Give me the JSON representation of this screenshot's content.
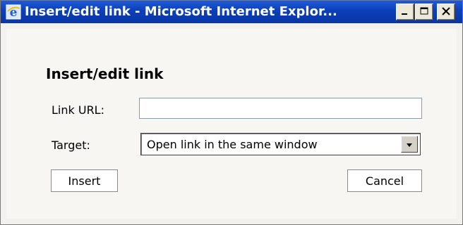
{
  "window": {
    "title": "Insert/edit link - Microsoft Internet Explor...",
    "icon": "ie-icon",
    "controls": [
      "minimize-icon",
      "maximize-icon",
      "close-icon"
    ],
    "title_bar_color": "#0b3fb8"
  },
  "dialog": {
    "heading": "Insert/edit link",
    "link_url_label": "Link URL:",
    "link_url_value": "",
    "target_label": "Target:",
    "target_selected": "Open link in the same window",
    "insert_label": "Insert",
    "cancel_label": "Cancel"
  }
}
